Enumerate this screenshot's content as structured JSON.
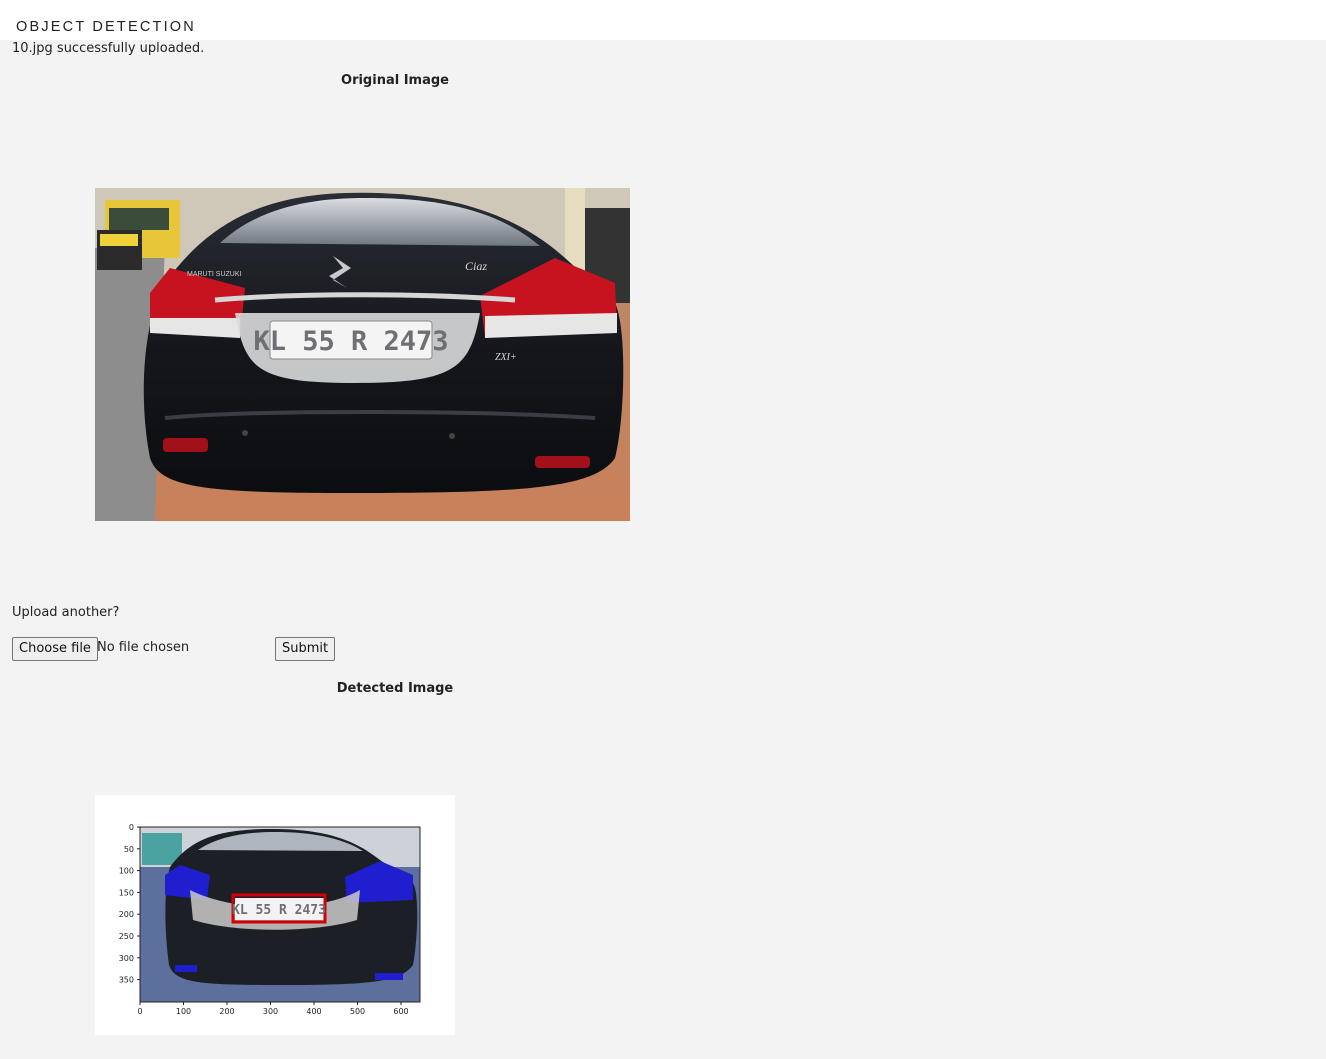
{
  "header": {
    "title": "OBJECT DETECTION"
  },
  "status_message": "10.jpg successfully uploaded.",
  "original": {
    "heading": "Original Image",
    "plate_text": "KL 55 R 2473",
    "brand_badge": "MARUTI SUZUKI",
    "model_badge": "Ciaz",
    "trim_badge": "ZXI+"
  },
  "upload": {
    "prompt": "Upload another?",
    "choose_label": "Choose file",
    "no_file_text": "No file chosen",
    "submit_label": "Submit"
  },
  "detected": {
    "heading": "Detected Image",
    "plate_text": "KL 55 R 2473",
    "box_color": "#d40000",
    "x_ticks": [
      "0",
      "100",
      "200",
      "300",
      "400",
      "500",
      "600"
    ],
    "y_ticks": [
      "0",
      "50",
      "100",
      "150",
      "200",
      "250",
      "300",
      "350"
    ]
  }
}
